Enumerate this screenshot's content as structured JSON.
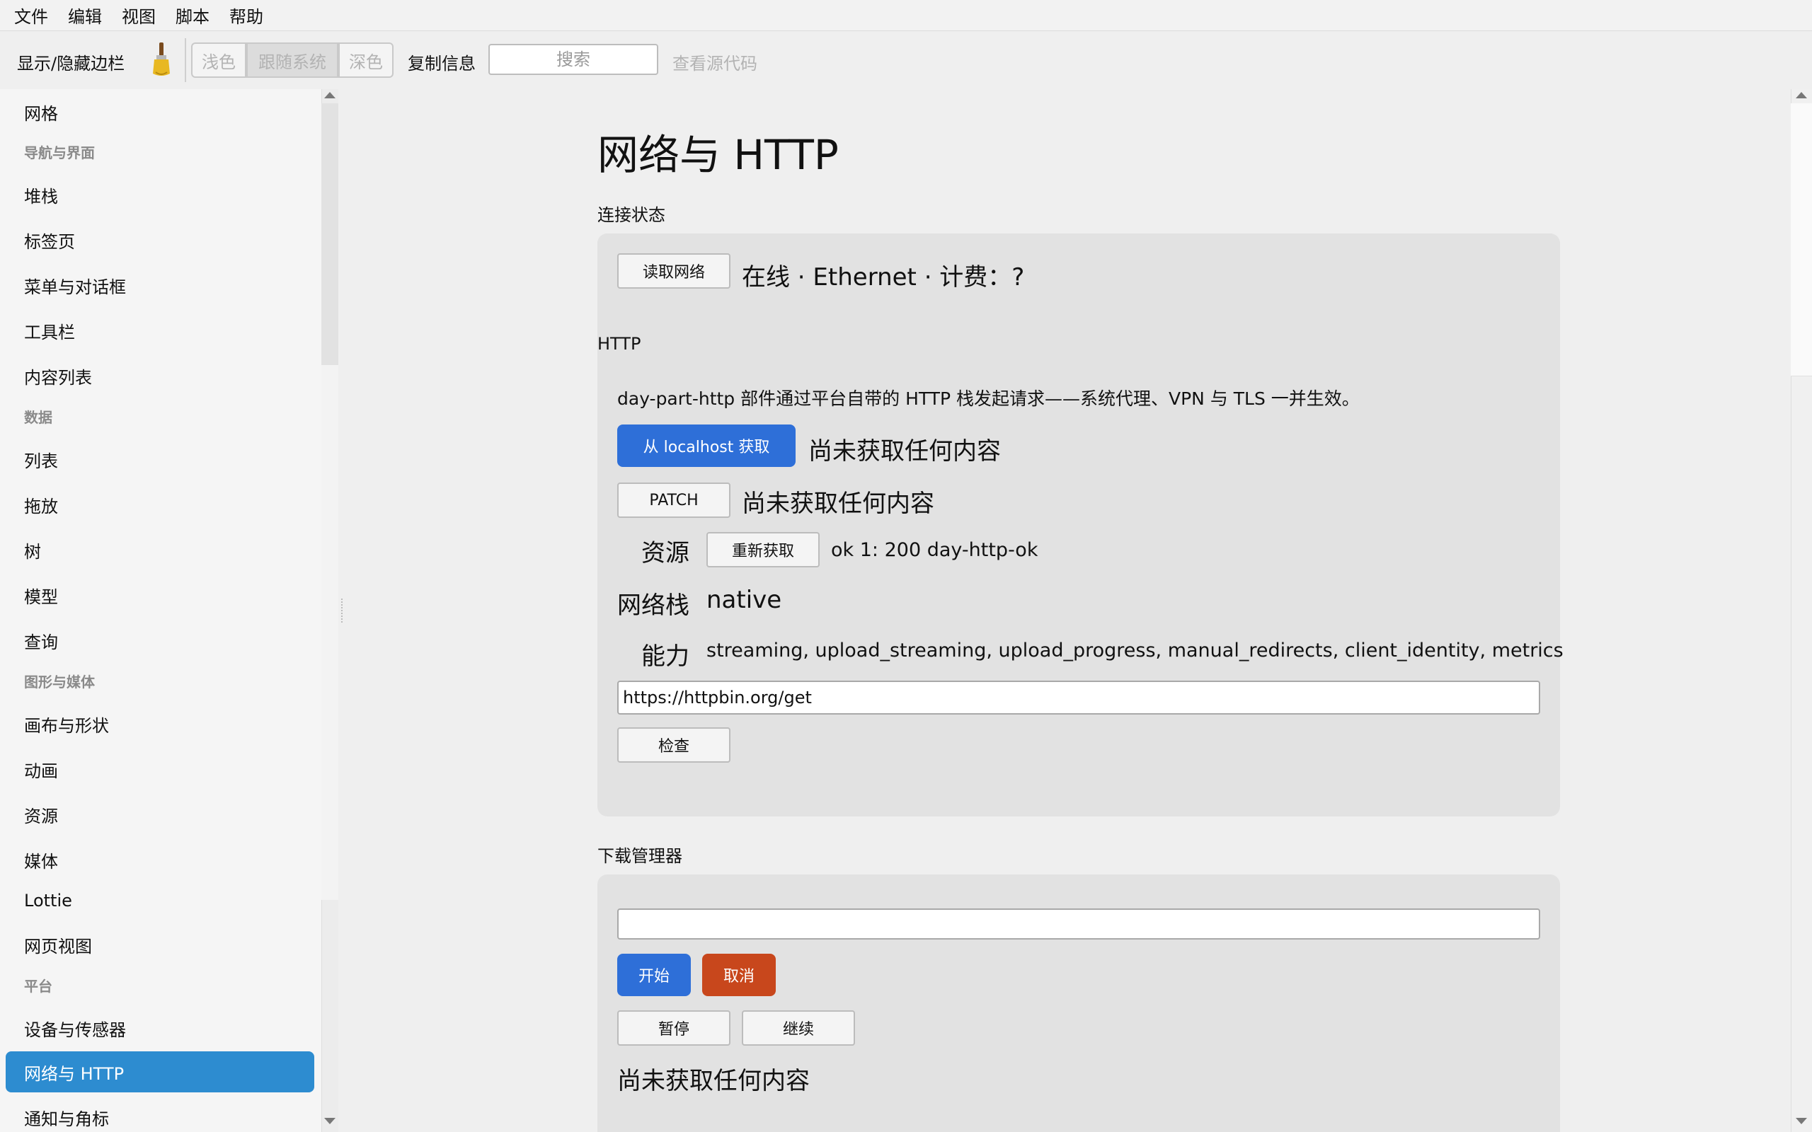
{
  "menubar": {
    "items": [
      "文件",
      "编辑",
      "视图",
      "脚本",
      "帮助"
    ]
  },
  "toolbar": {
    "toggle_sidebar": "显示/隐藏边栏",
    "theme_light": "浅色",
    "theme_system": "跟随系统",
    "theme_dark": "深色",
    "copy_info": "复制信息",
    "search_placeholder": "搜索",
    "view_source": "查看源代码"
  },
  "sidebar": {
    "items": [
      {
        "type": "item",
        "label": "网格"
      },
      {
        "type": "header",
        "label": "导航与界面"
      },
      {
        "type": "item",
        "label": "堆栈"
      },
      {
        "type": "item",
        "label": "标签页"
      },
      {
        "type": "item",
        "label": "菜单与对话框"
      },
      {
        "type": "item",
        "label": "工具栏"
      },
      {
        "type": "item",
        "label": "内容列表"
      },
      {
        "type": "header",
        "label": "数据"
      },
      {
        "type": "item",
        "label": "列表"
      },
      {
        "type": "item",
        "label": "拖放"
      },
      {
        "type": "item",
        "label": "树"
      },
      {
        "type": "item",
        "label": "模型"
      },
      {
        "type": "item",
        "label": "查询"
      },
      {
        "type": "header",
        "label": "图形与媒体"
      },
      {
        "type": "item",
        "label": "画布与形状"
      },
      {
        "type": "item",
        "label": "动画"
      },
      {
        "type": "item",
        "label": "资源"
      },
      {
        "type": "item",
        "label": "媒体"
      },
      {
        "type": "item",
        "label": "Lottie"
      },
      {
        "type": "item",
        "label": "网页视图"
      },
      {
        "type": "header",
        "label": "平台"
      },
      {
        "type": "item",
        "label": "设备与传感器"
      },
      {
        "type": "item",
        "label": "网络与 HTTP",
        "selected": true
      },
      {
        "type": "item",
        "label": "通知与角标"
      }
    ]
  },
  "page": {
    "title": "网络与 HTTP",
    "connection": {
      "title": "连接状态",
      "read_button": "读取网络",
      "status": "在线 · Ethernet · 计费：?"
    },
    "http": {
      "title": "HTTP",
      "description": "day-part-http 部件通过平台自带的 HTTP 栈发起请求——系统代理、VPN 与 TLS 一并生效。",
      "fetch_button": "从 localhost 获取",
      "fetch_result": "尚未获取任何内容",
      "patch_button": "PATCH",
      "patch_result": "尚未获取任何内容",
      "resource_label": "资源",
      "refetch_button": "重新获取",
      "resource_result": "ok 1: 200 day-http-ok",
      "stack_label": "网络栈",
      "stack_value": "native",
      "capabilities_label": "能力",
      "capabilities_value": "streaming, upload_streaming, upload_progress, manual_redirects, client_identity, metrics",
      "url_value": "https://httpbin.org/get",
      "inspect_button": "检查"
    },
    "downloads": {
      "title": "下载管理器",
      "url_value": "",
      "start_button": "开始",
      "cancel_button": "取消",
      "pause_button": "暂停",
      "resume_button": "继续",
      "status": "尚未获取任何内容"
    }
  },
  "colors": {
    "accent_selected": "#2d8cd0",
    "primary_button": "#2e6fd8",
    "danger_button": "#c8471c"
  }
}
